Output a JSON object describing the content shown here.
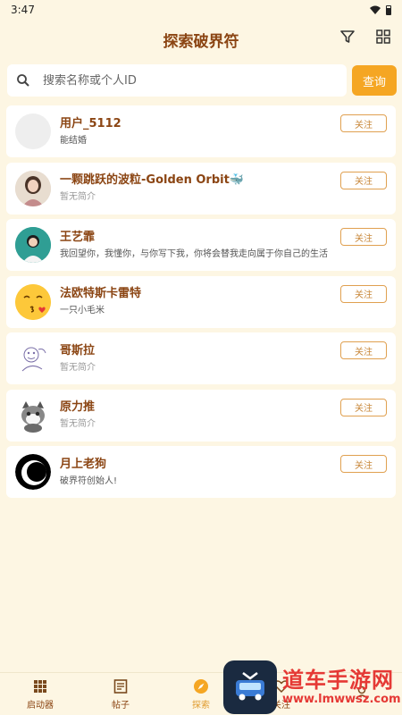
{
  "status": {
    "time": "3:47"
  },
  "header": {
    "title": "探索破界符"
  },
  "search": {
    "placeholder": "搜索名称或个人ID",
    "button_label": "查询"
  },
  "users": [
    {
      "name": "用户_5112",
      "bio": "能结婚",
      "follow_label": "关注"
    },
    {
      "name": "一颗跳跃的波粒-Golden Orbit🐳",
      "bio": "暂无简介",
      "follow_label": "关注"
    },
    {
      "name": "王艺霏",
      "bio": "我回望你，我懂你，与你写下我，你将会替我走向属于你自己的生活，你与我同在",
      "follow_label": "关注"
    },
    {
      "name": "法欧特斯卡雷特",
      "bio": "一只小毛米",
      "follow_label": "关注"
    },
    {
      "name": "哥斯拉",
      "bio": "暂无简介",
      "follow_label": "关注"
    },
    {
      "name": "原力推",
      "bio": "暂无简介",
      "follow_label": "关注"
    },
    {
      "name": "月上老狗",
      "bio": "破界符创始人!",
      "follow_label": "关注"
    }
  ],
  "nav": [
    {
      "label": "启动器"
    },
    {
      "label": "帖子"
    },
    {
      "label": "探索"
    },
    {
      "label": "关注"
    },
    {
      "label": ""
    }
  ],
  "watermark": {
    "cn": "道车手游网",
    "url": "www.lmwwsz.com"
  },
  "colors": {
    "accent": "#f5a623",
    "title": "#8b4513",
    "background": "#fdf6e3"
  }
}
